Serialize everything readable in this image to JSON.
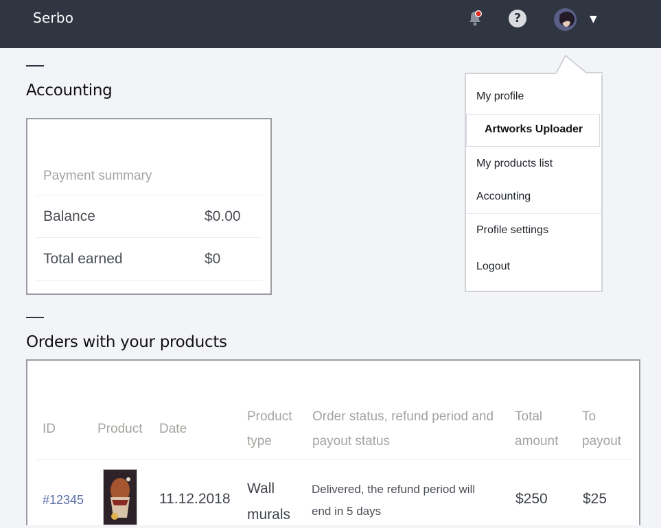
{
  "header": {
    "brand": "Serbo",
    "help_symbol": "?",
    "caret_symbol": "▼",
    "icons": [
      "bell-icon",
      "help-icon",
      "avatar",
      "chevron-down-icon"
    ],
    "notification_dot_color": "#e0281f"
  },
  "accounting": {
    "title": "Accounting",
    "summary_label": "Payment summary",
    "rows": [
      {
        "label": "Balance",
        "value": "$0.00"
      },
      {
        "label": "Total earned",
        "value": "$0"
      }
    ]
  },
  "orders": {
    "title": "Orders with your products",
    "columns": [
      "ID",
      "Product",
      "Date",
      "Product type",
      "Order status, refund period and payout status",
      "Total amount",
      "To payout"
    ],
    "rows": [
      {
        "id": "#12345",
        "date": "11.12.2018",
        "type": "Wall murals",
        "status": "Delivered, the refund period will end in 5 days",
        "total": "$250",
        "payout": "$25"
      }
    ]
  },
  "user_menu": {
    "items": [
      "My profile",
      "Artworks Uploader",
      "My products list",
      "Accounting",
      "Profile settings",
      "Logout"
    ]
  }
}
